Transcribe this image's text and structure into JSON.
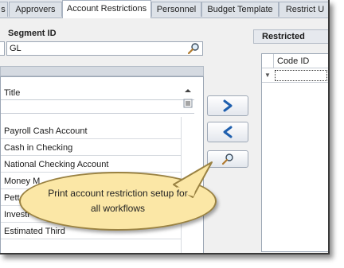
{
  "tabs": [
    {
      "label": "s",
      "active": false
    },
    {
      "label": "Approvers",
      "active": false
    },
    {
      "label": "Account Restrictions",
      "active": true
    },
    {
      "label": "Personnel",
      "active": false
    },
    {
      "label": "Budget Template",
      "active": false
    },
    {
      "label": "Restrict U",
      "active": false
    }
  ],
  "segment": {
    "label": "Segment ID",
    "value": "GL"
  },
  "available_grid": {
    "column": "Title",
    "rows": [
      "Payroll Cash Account",
      "Cash in Checking",
      "National Checking Account",
      "Money M",
      "Pett",
      "Investi",
      "Estimated Third"
    ]
  },
  "restricted": {
    "title": "Restricted",
    "column": "Code ID"
  },
  "callout": {
    "line1": "Print account restriction setup for",
    "line2": "all workflows"
  },
  "icons": {
    "lookup": "magnifier-icon",
    "add": "chevron-right-icon",
    "remove": "chevron-left-icon",
    "print": "magnifier-icon"
  }
}
